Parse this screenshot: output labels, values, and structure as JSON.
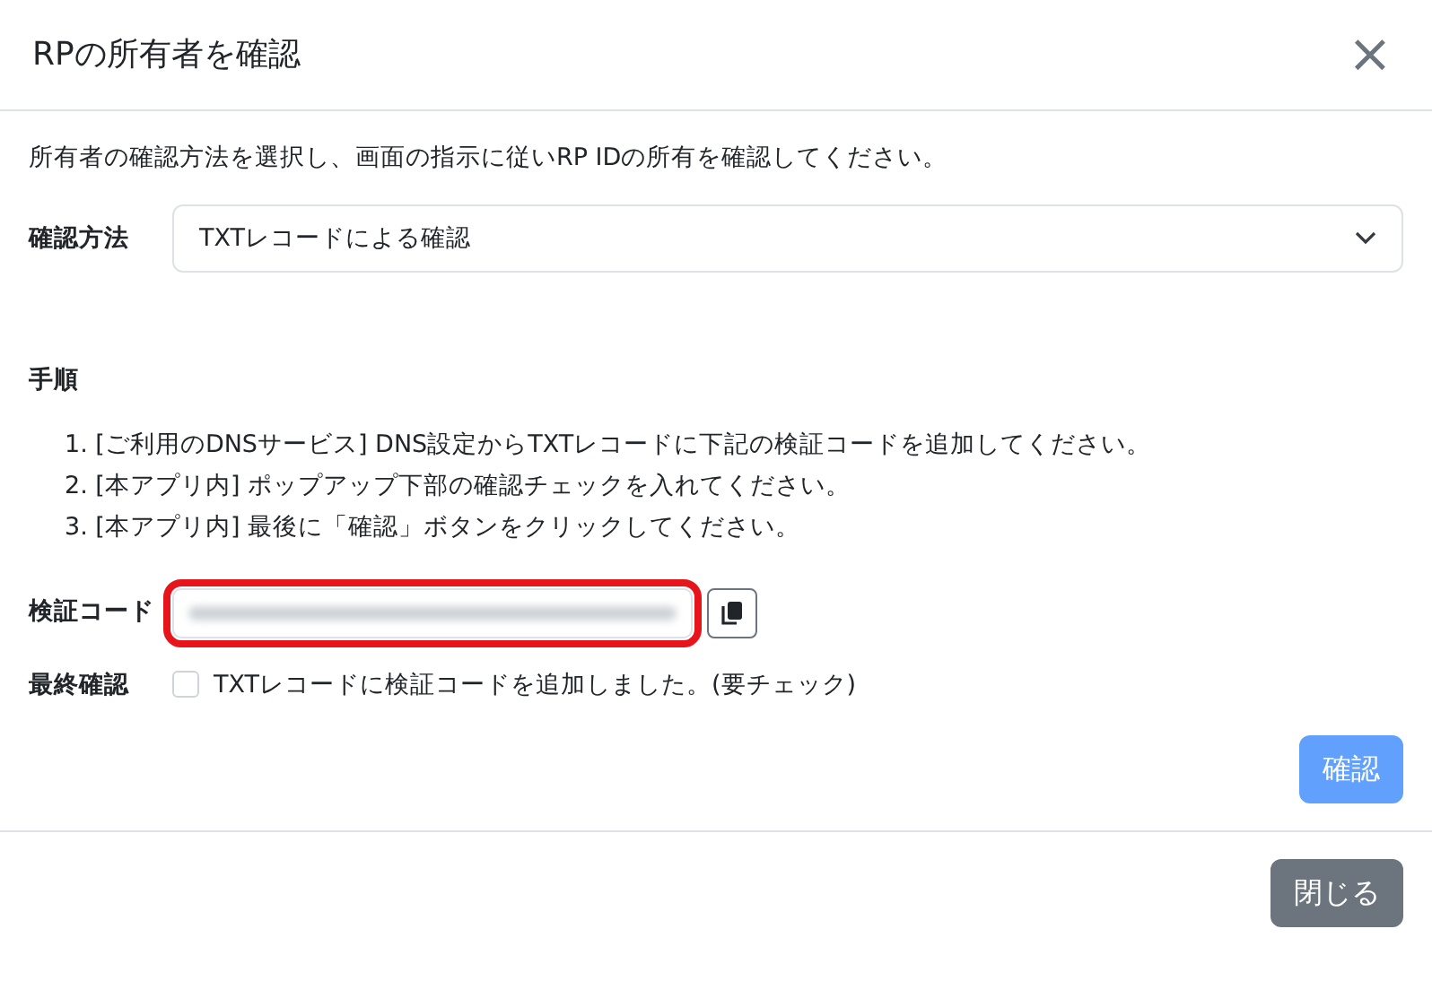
{
  "modal": {
    "title": "RPの所有者を確認",
    "close_symbol": "×"
  },
  "intro": "所有者の確認方法を選択し、画面の指示に従いRP IDの所有を確認してください。",
  "method": {
    "label": "確認方法",
    "value": "TXTレコードによる確認"
  },
  "steps_heading": "手順",
  "steps": [
    {
      "number": "1.",
      "text": "[ご利用のDNSサービス] DNS設定からTXTレコードに下記の検証コードを追加してください。"
    },
    {
      "number": "2.",
      "text": "[本アプリ内] ポップアップ下部の確認チェックを入れてください。"
    },
    {
      "number": "3.",
      "text": "[本アプリ内] 最後に「確認」ボタンをクリックしてください。"
    }
  ],
  "verification_code": {
    "label": "検証コード",
    "blurred": true,
    "highlighted": true
  },
  "final_check": {
    "label": "最終確認",
    "text": "TXTレコードに検証コードを追加しました。(要チェック)",
    "checked": false
  },
  "confirm_button": {
    "label": "確認",
    "disabled": true
  },
  "close_button": {
    "label": "閉じる"
  }
}
